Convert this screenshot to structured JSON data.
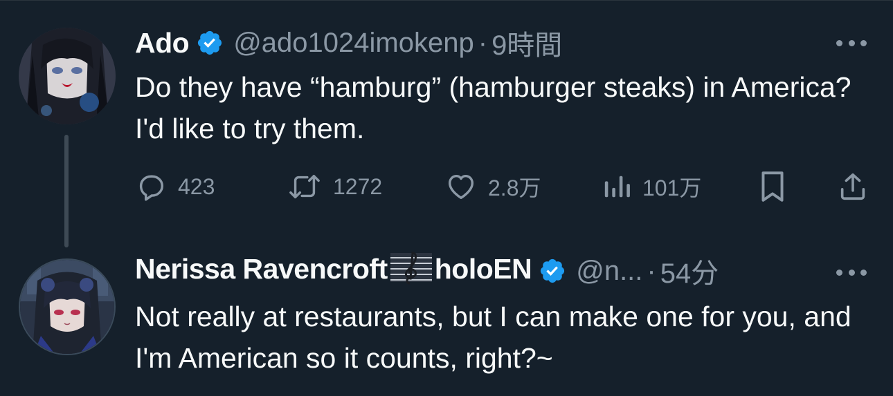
{
  "colors": {
    "background": "#15202b",
    "text": "#f7f9f9",
    "secondary": "#8b98a5",
    "verified": "#1d9bf0"
  },
  "tweets": [
    {
      "author": {
        "name": "Ado",
        "handle": "@ado1024imokenp",
        "verified": true,
        "avatar_icon": "avatar-anime-character"
      },
      "separator": "·",
      "time": "9時間",
      "text": "Do they have “hamburg” (hamburger steaks) in America? I'd like to try them.",
      "actions": {
        "replies": "423",
        "retweets": "1272",
        "likes": "2.8万",
        "views": "101万"
      }
    },
    {
      "author": {
        "name_prefix": "Nerissa Ravencroft",
        "name_emoji": "musical-score-icon",
        "name_suffix": "holoEN",
        "verified": true,
        "handle": "@n...",
        "avatar_icon": "avatar-anime-character"
      },
      "separator": "·",
      "time": "54分",
      "text": "Not really at restaurants, but I can make one for you, and I'm American so it counts, right?~"
    }
  ]
}
